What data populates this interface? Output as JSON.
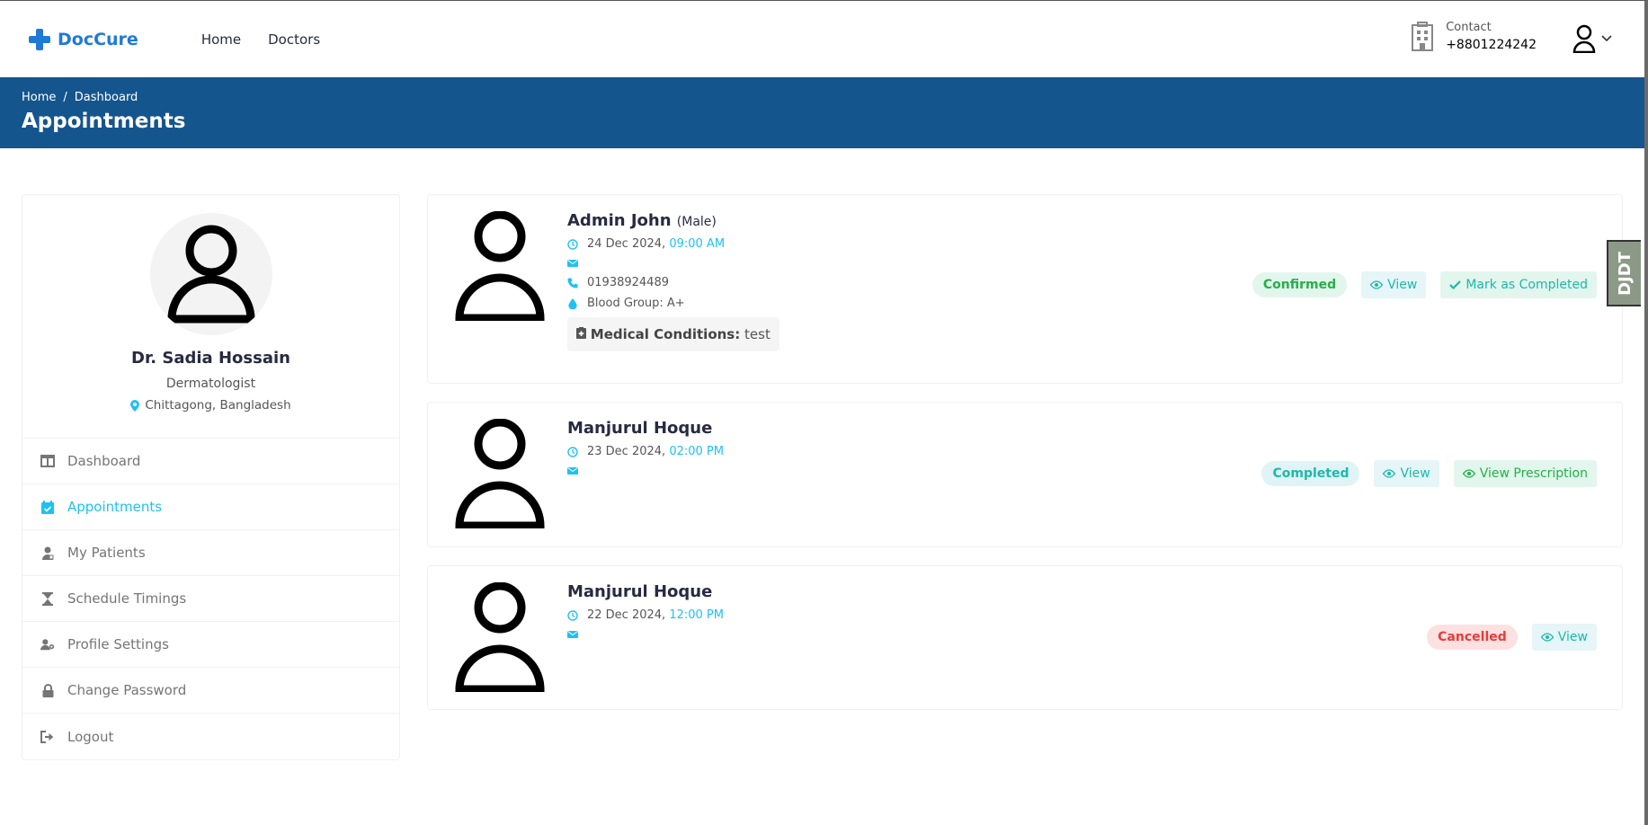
{
  "header": {
    "brand": "DocCure",
    "nav": [
      "Home",
      "Doctors"
    ],
    "contact_label": "Contact",
    "contact_number": "+8801224242"
  },
  "banner": {
    "breadcrumb": [
      "Home",
      "Dashboard"
    ],
    "separator": "/",
    "title": "Appointments"
  },
  "doctor": {
    "name": "Dr. Sadia Hossain",
    "specialty": "Dermatologist",
    "location": "Chittagong, Bangladesh"
  },
  "menu": [
    {
      "label": "Dashboard",
      "icon": "columns-icon"
    },
    {
      "label": "Appointments",
      "icon": "calendar-check-icon",
      "active": true
    },
    {
      "label": "My Patients",
      "icon": "patient-icon"
    },
    {
      "label": "Schedule Timings",
      "icon": "hourglass-icon"
    },
    {
      "label": "Profile Settings",
      "icon": "user-cog-icon"
    },
    {
      "label": "Change Password",
      "icon": "lock-icon"
    },
    {
      "label": "Logout",
      "icon": "sign-out-icon"
    }
  ],
  "appointments": [
    {
      "name": "Admin John",
      "gender": "(Male)",
      "date": "24 Dec 2024,",
      "time": "09:00 AM",
      "phone": "01938924489",
      "blood_group": "Blood Group: A+",
      "med_label": "Medical Conditions:",
      "med_value": "test",
      "status": "Confirmed",
      "view_label": "View",
      "action_label": "Mark as Completed"
    },
    {
      "name": "Manjurul Hoque",
      "date": "23 Dec 2024,",
      "time": "02:00 PM",
      "status": "Completed",
      "view_label": "View",
      "action_label": "View Prescription"
    },
    {
      "name": "Manjurul Hoque",
      "date": "22 Dec 2024,",
      "time": "12:00 PM",
      "status": "Cancelled",
      "view_label": "View"
    }
  ],
  "debug_toolbar": "DJDT",
  "colors": {
    "brand": "#1f7ad7",
    "banner": "#15558d",
    "accent": "#20c0f3"
  }
}
